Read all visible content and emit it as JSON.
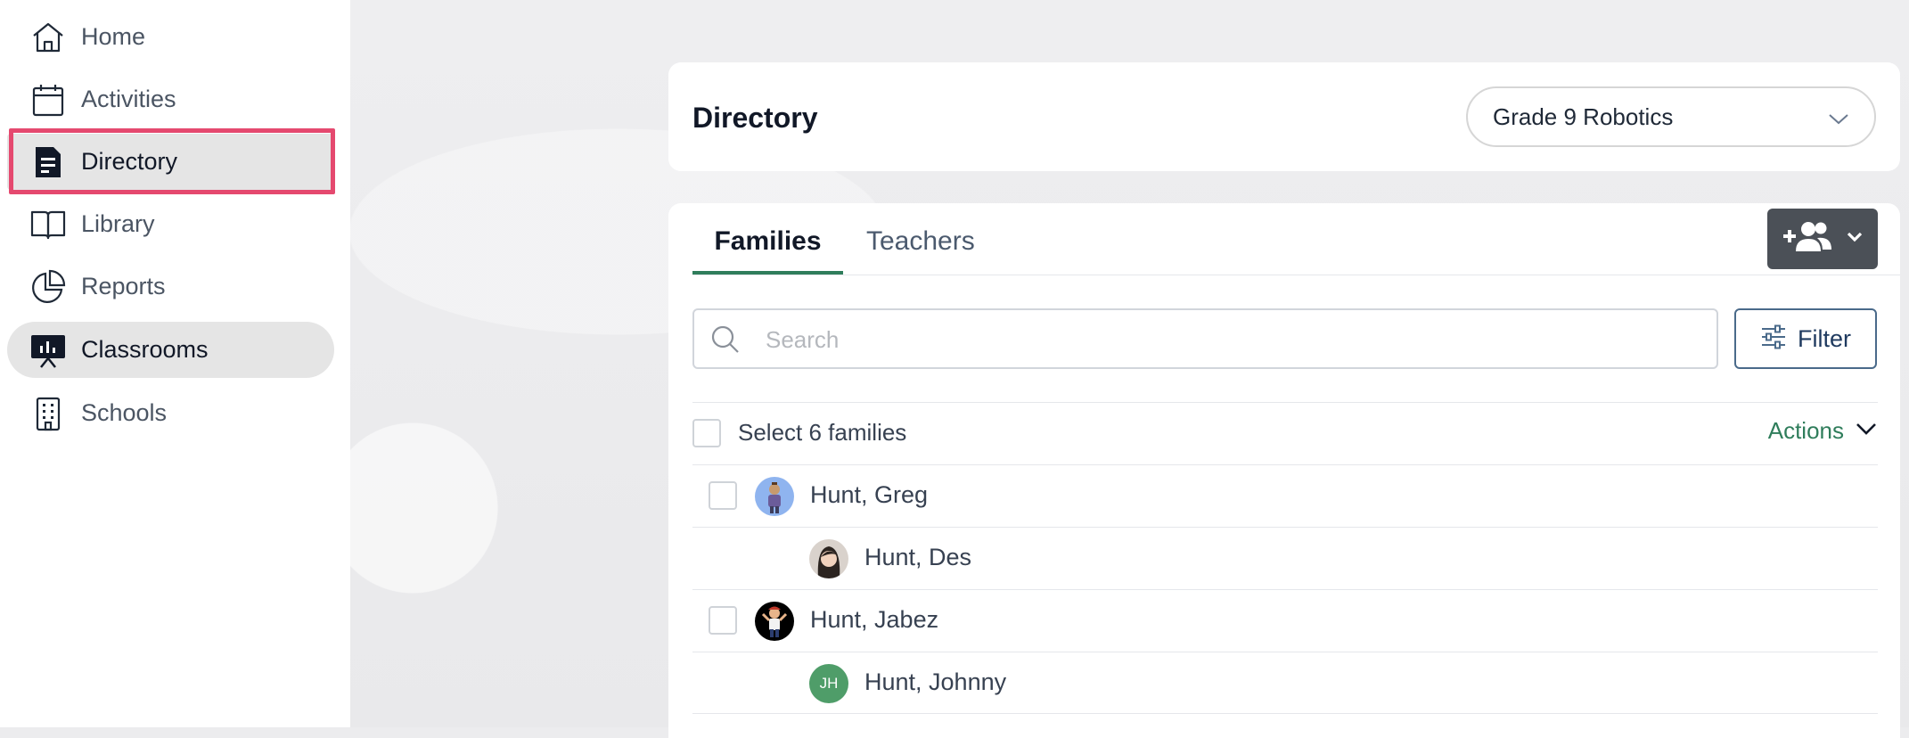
{
  "sidebar": {
    "items": [
      {
        "label": "Home",
        "icon": "home-icon"
      },
      {
        "label": "Activities",
        "icon": "calendar-icon"
      },
      {
        "label": "Directory",
        "icon": "document-icon"
      },
      {
        "label": "Library",
        "icon": "book-icon"
      },
      {
        "label": "Reports",
        "icon": "pie-chart-icon"
      },
      {
        "label": "Classrooms",
        "icon": "presentation-board-icon"
      },
      {
        "label": "Schools",
        "icon": "building-icon"
      }
    ]
  },
  "header": {
    "title": "Directory",
    "class_select": {
      "value": "Grade 9 Robotics"
    }
  },
  "tabs": [
    {
      "label": "Families"
    },
    {
      "label": "Teachers"
    }
  ],
  "search": {
    "placeholder": "Search",
    "value": ""
  },
  "filter": {
    "label": "Filter"
  },
  "list": {
    "select_all_label": "Select 6 families",
    "actions_label": "Actions",
    "rows": [
      {
        "name": "Hunt, Greg"
      },
      {
        "name": "Hunt, Des"
      },
      {
        "name": "Hunt, Jabez"
      },
      {
        "name": "Hunt, Johnny",
        "initials": "JH"
      }
    ]
  },
  "colors": {
    "accent_green": "#2f7d5b",
    "highlight_pink": "#e5496f",
    "dark_button": "#4b5057",
    "avatar_green": "#4f9d69"
  }
}
